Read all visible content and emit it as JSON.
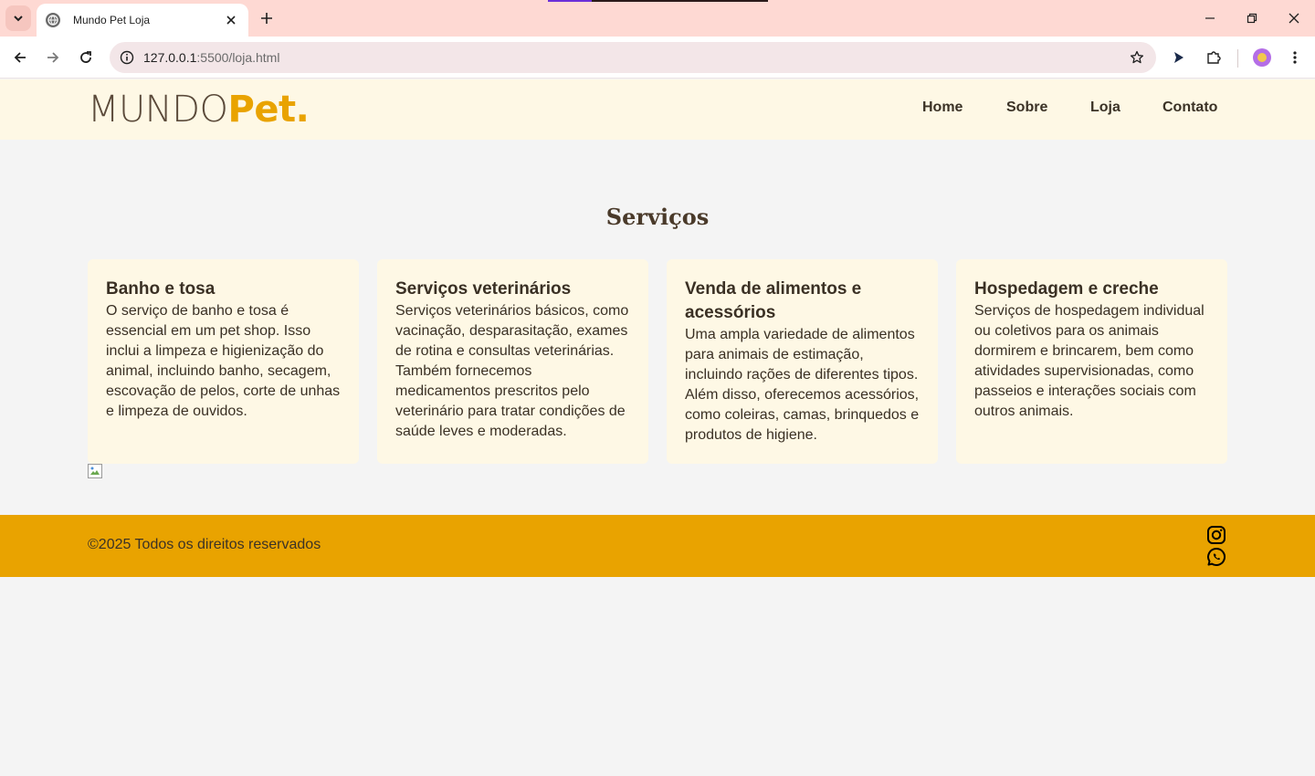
{
  "browser": {
    "tab_title": "Mundo Pet Loja",
    "url_host": "127.0.0.1",
    "url_path": ":5500/loja.html"
  },
  "site": {
    "logo": {
      "part1": "MUNDO",
      "part2": "Pet."
    },
    "nav": [
      "Home",
      "Sobre",
      "Loja",
      "Contato"
    ],
    "services_title": "Serviços",
    "cards": [
      {
        "title": "Banho e tosa",
        "text": "O serviço de banho e tosa é essencial em um pet shop. Isso inclui a limpeza e higienização do animal, incluindo banho, secagem, escovação de pelos, corte de unhas e limpeza de ouvidos."
      },
      {
        "title": "Serviços veterinários",
        "text": "Serviços veterinários básicos, como vacinação, desparasitação, exames de rotina e consultas veterinárias. Também fornecemos medicamentos prescritos pelo veterinário para tratar condições de saúde leves e moderadas."
      },
      {
        "title": "Venda de alimentos e acessórios",
        "text": "Uma ampla variedade de alimentos para animais de estimação, incluindo rações de diferentes tipos. Além disso, oferecemos acessórios, como coleiras, camas, brinquedos e produtos de higiene."
      },
      {
        "title": "Hospedagem e creche",
        "text": "Serviços de hospedagem individual ou coletivos para os animais dormirem e brincarem, bem como atividades supervisionadas, como passeios e interações sociais com outros animais."
      }
    ],
    "footer": {
      "copyright": "©2025 Todos os direitos reservados",
      "social_icons": [
        "instagram-icon",
        "whatsapp-icon"
      ]
    }
  },
  "colors": {
    "tabstrip": "#fed9d3",
    "header_bg": "#fef8e5",
    "card_bg": "#fef8e5",
    "footer_bg": "#e9a300",
    "brand_accent": "#e9a300",
    "text_dark": "#3b3226",
    "page_bg": "#f4f4f4"
  }
}
